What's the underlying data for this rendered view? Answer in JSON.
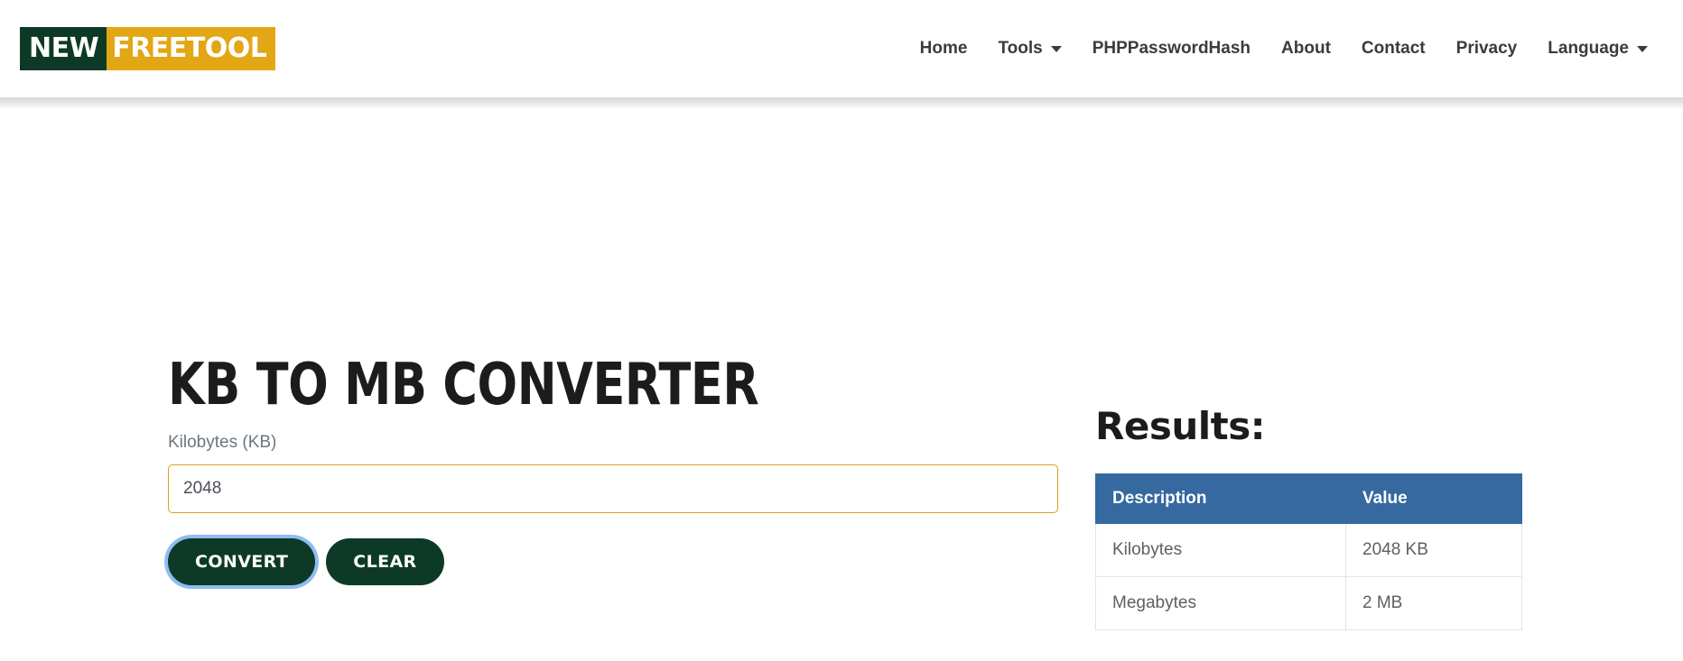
{
  "brand": {
    "part1": "NEW",
    "part2": "FREETOOL",
    "color_dark": "#0d3a26",
    "color_gold": "#e3a614"
  },
  "nav": {
    "items": [
      {
        "label": "Home",
        "has_caret": false
      },
      {
        "label": "Tools",
        "has_caret": true
      },
      {
        "label": "PHPPasswordHash",
        "has_caret": false
      },
      {
        "label": "About",
        "has_caret": false
      },
      {
        "label": "Contact",
        "has_caret": false
      },
      {
        "label": "Privacy",
        "has_caret": false
      },
      {
        "label": "Language",
        "has_caret": true
      }
    ]
  },
  "page": {
    "title": "KB TO MB CONVERTER"
  },
  "form": {
    "label": "Kilobytes (KB)",
    "value": "2048",
    "placeholder": "",
    "convert_label": "Convert",
    "clear_label": "Clear",
    "input_border_color": "#d9a31a",
    "focus_ring_color": "#8fbdf0"
  },
  "results": {
    "title": "Results:",
    "header_color": "#35699f",
    "columns": [
      "Description",
      "Value"
    ],
    "rows": [
      {
        "description": "Kilobytes",
        "value": "2048 KB"
      },
      {
        "description": "Megabytes",
        "value": "2 MB"
      }
    ]
  }
}
